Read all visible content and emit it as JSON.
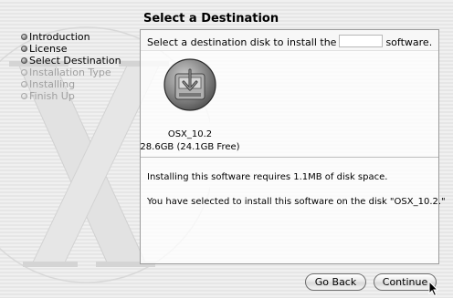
{
  "header": {
    "title": "Select a Destination"
  },
  "steps": [
    {
      "label": "Introduction",
      "state": "done"
    },
    {
      "label": "License",
      "state": "done"
    },
    {
      "label": "Select Destination",
      "state": "current"
    },
    {
      "label": "Installation Type",
      "state": "pending"
    },
    {
      "label": "Installing",
      "state": "pending"
    },
    {
      "label": "Finish Up",
      "state": "pending"
    }
  ],
  "panel": {
    "instruction_prefix": "Select a destination disk to install the",
    "instruction_suffix": "software."
  },
  "disk": {
    "name": "OSX_10.2",
    "size": "28.6GB (24.1GB Free)",
    "icon": "hard-disk-icon"
  },
  "info": {
    "line1": "Installing this software requires 1.1MB of disk space.",
    "line2": "You have selected to install this software on the disk \"OSX_10.2.\""
  },
  "buttons": {
    "back": "Go Back",
    "continue": "Continue"
  }
}
